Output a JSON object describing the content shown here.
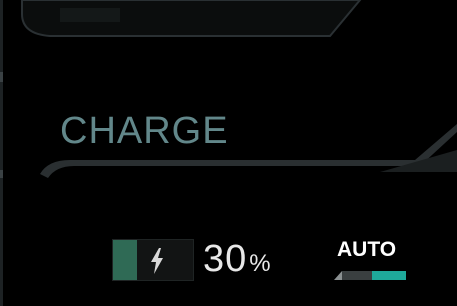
{
  "section": {
    "title": "CHARGE"
  },
  "battery": {
    "level": 0.3,
    "value": "30",
    "unit": "%",
    "icon": "lightning-bolt-icon",
    "fill_color": "#2f6a55"
  },
  "auto_toggle": {
    "label": "AUTO",
    "active_color": "#1ea99a"
  },
  "colors": {
    "background": "#000000",
    "title": "#62878a",
    "panel_edge": "#3b4245"
  }
}
